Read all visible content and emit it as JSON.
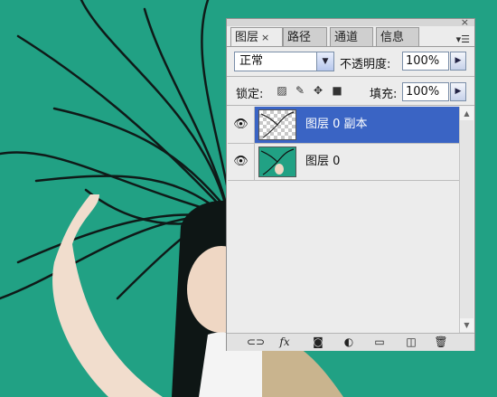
{
  "panel": {
    "tabs": [
      {
        "label": "图层",
        "close": "×",
        "active": true
      },
      {
        "label": "路径",
        "active": false
      },
      {
        "label": "通道",
        "active": false
      },
      {
        "label": "信息",
        "active": false
      }
    ],
    "close_glyph": "×",
    "blend_mode": "正常",
    "opacity_label": "不透明度:",
    "opacity_value": "100%",
    "lock_label": "锁定:",
    "fill_label": "填充:",
    "fill_value": "100%",
    "layers": [
      {
        "name": "图层 0 副本",
        "selected": true,
        "visible": true,
        "thumb": "checker"
      },
      {
        "name": "图层 0",
        "selected": false,
        "visible": true,
        "thumb": "photo"
      }
    ],
    "bottom_icons": [
      "link-icon",
      "fx-icon",
      "mask-icon",
      "adjustment-icon",
      "folder-icon",
      "new-layer-icon",
      "trash-icon"
    ],
    "fx_label": "fx"
  },
  "colors": {
    "background": "#21a184",
    "selection": "#3a64c4",
    "panel": "#ececec"
  }
}
